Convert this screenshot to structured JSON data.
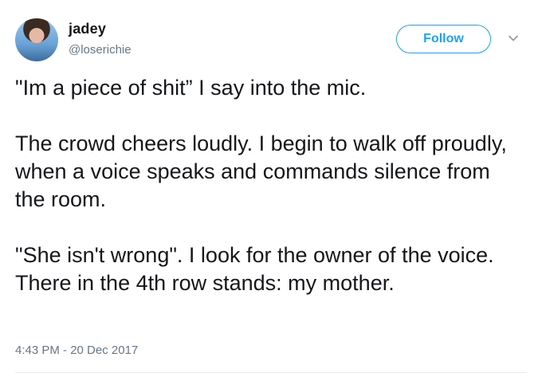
{
  "author": {
    "display_name": "jadey",
    "handle": "@loserichie",
    "avatar_icon": "profile-photo"
  },
  "header": {
    "follow_label": "Follow",
    "menu_icon": "chevron-down-icon",
    "accent_color": "#1da1f2"
  },
  "tweet": {
    "paragraphs": [
      "\"Im a piece of shit” I say into the mic.",
      "The crowd cheers loudly. I begin to walk off proudly, when a voice speaks and commands silence from the room.",
      "\"She isn't wrong\". I look for the owner of the voice. There in the 4th row stands: my mother."
    ],
    "timestamp": "4:43 PM - 20 Dec 2017"
  }
}
